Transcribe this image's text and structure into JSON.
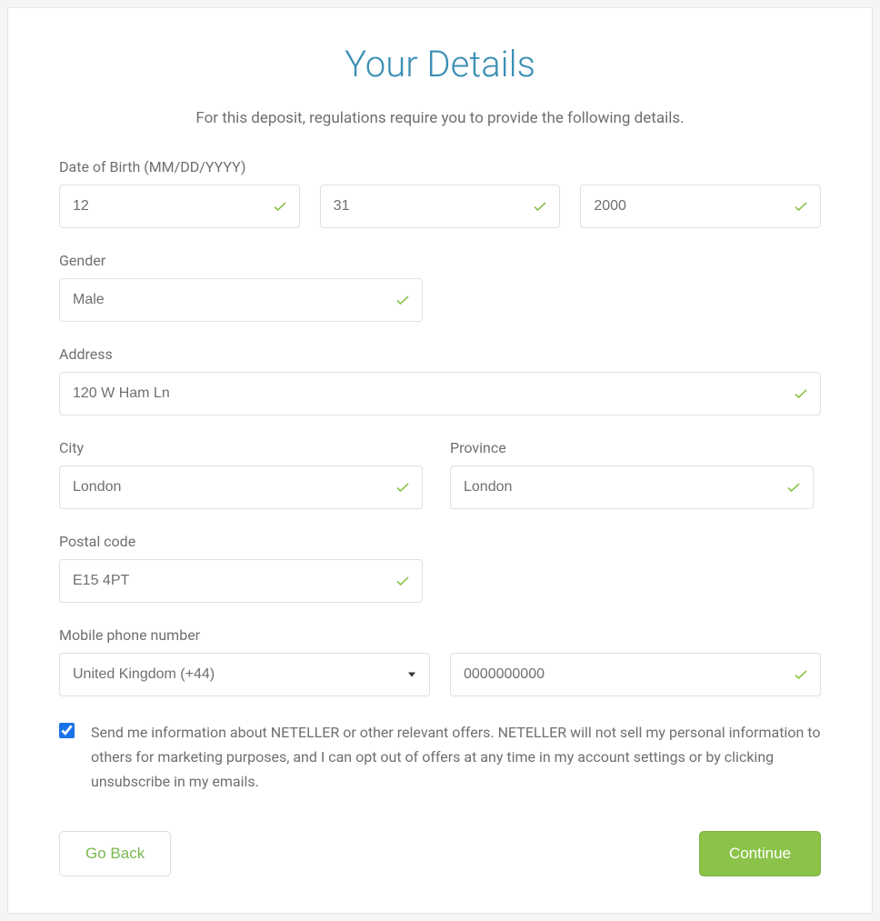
{
  "header": {
    "title": "Your Details",
    "subtitle": "For this deposit, regulations require you to provide the following details."
  },
  "dob": {
    "label": "Date of Birth (MM/DD/YYYY)",
    "month": "12",
    "day": "31",
    "year": "2000"
  },
  "gender": {
    "label": "Gender",
    "value": "Male"
  },
  "address": {
    "label": "Address",
    "value": "120 W Ham Ln"
  },
  "city": {
    "label": "City",
    "value": "London"
  },
  "province": {
    "label": "Province",
    "value": "London"
  },
  "postal": {
    "label": "Postal code",
    "value": "E15 4PT"
  },
  "phone": {
    "label": "Mobile phone number",
    "country": "United Kingdom (+44)",
    "number": "0000000000"
  },
  "consent": {
    "checked": true,
    "label": "Send me information about NETELLER or other relevant offers. NETELLER will not sell my personal information to others for marketing purposes, and I can opt out of offers at any time in my account settings or by clicking unsubscribe in my emails."
  },
  "buttons": {
    "back": "Go Back",
    "continue": "Continue"
  },
  "colors": {
    "title": "#3b8fb5",
    "primary": "#8bc34a",
    "check": "#8bc34a"
  }
}
